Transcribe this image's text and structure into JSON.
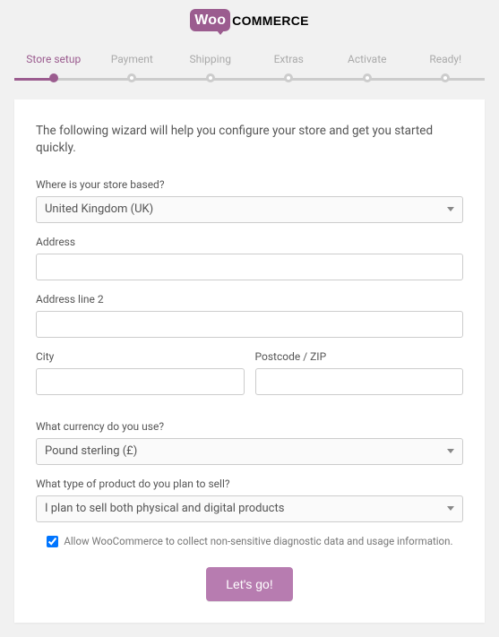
{
  "logo": {
    "part1": "Woo",
    "part2": "COMMERCE"
  },
  "stepper": {
    "steps": [
      {
        "label": "Store setup",
        "active": true
      },
      {
        "label": "Payment",
        "active": false
      },
      {
        "label": "Shipping",
        "active": false
      },
      {
        "label": "Extras",
        "active": false
      },
      {
        "label": "Activate",
        "active": false
      },
      {
        "label": "Ready!",
        "active": false
      }
    ]
  },
  "intro": "The following wizard will help you configure your store and get you started quickly.",
  "fields": {
    "store_location": {
      "label": "Where is your store based?",
      "value": "United Kingdom (UK)"
    },
    "address": {
      "label": "Address",
      "value": ""
    },
    "address2": {
      "label": "Address line 2",
      "value": ""
    },
    "city": {
      "label": "City",
      "value": ""
    },
    "postcode": {
      "label": "Postcode / ZIP",
      "value": ""
    },
    "currency": {
      "label": "What currency do you use?",
      "value": "Pound sterling (£)"
    },
    "product_type": {
      "label": "What type of product do you plan to sell?",
      "value": "I plan to sell both physical and digital products"
    }
  },
  "consent": {
    "checked": true,
    "label": "Allow WooCommerce to collect non-sensitive diagnostic data and usage information."
  },
  "submit": {
    "label": "Let's go!"
  }
}
